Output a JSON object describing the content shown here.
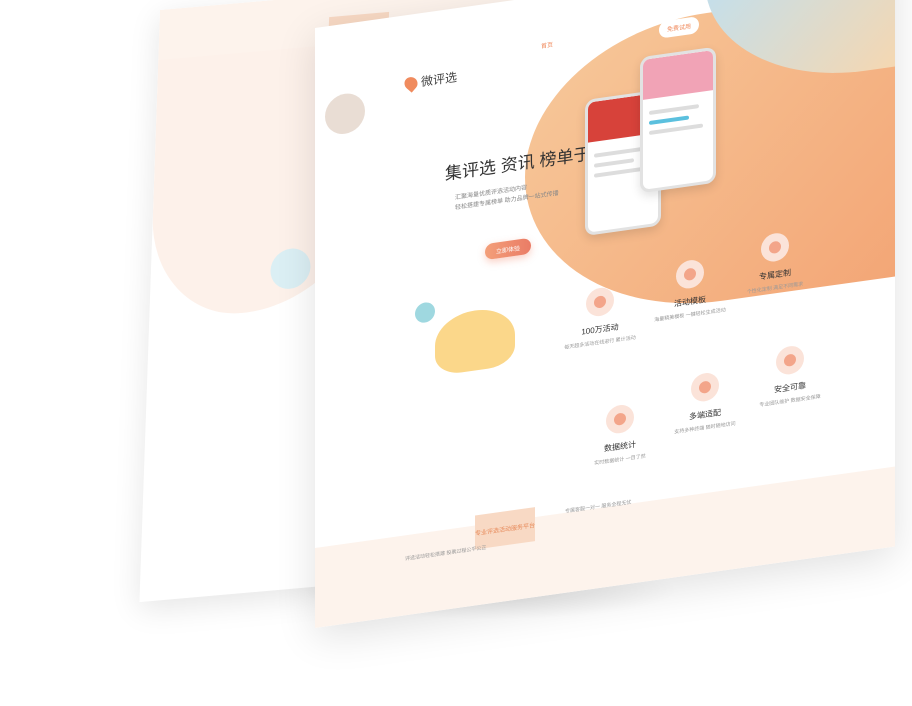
{
  "brand": {
    "name": "微评选"
  },
  "nav": {
    "items": [
      "首页",
      "功能",
      "关于"
    ],
    "button": "免费试用"
  },
  "hero": {
    "headline": "集评选 资讯 榜单于一体",
    "subline_1": "汇聚海量优质评选活动内容",
    "subline_2": "轻松搭建专属榜单 助力品牌一站式传播",
    "cta": "立即体验"
  },
  "features": [
    {
      "title": "100万活动",
      "desc": "每天超多活动在线进行 累计活动"
    },
    {
      "title": "活动模板",
      "desc": "海量精美模板 一键轻松生成活动"
    },
    {
      "title": "专属定制",
      "desc": "个性化定制 满足不同需求"
    },
    {
      "title": "数据统计",
      "desc": "实时数据统计 一目了然"
    },
    {
      "title": "多端适配",
      "desc": "支持多种终端 随时随地访问"
    },
    {
      "title": "安全可靠",
      "desc": "专业团队维护 数据安全保障"
    }
  ],
  "footer": {
    "badge": "专业评选活动服务平台",
    "items": [
      "评选活动轻松搭建 投票过程公平公正",
      "专属客服一对一 服务全程无忧"
    ]
  },
  "colors": {
    "accent": "#f08b5e",
    "soft": "#fdf3ec"
  }
}
